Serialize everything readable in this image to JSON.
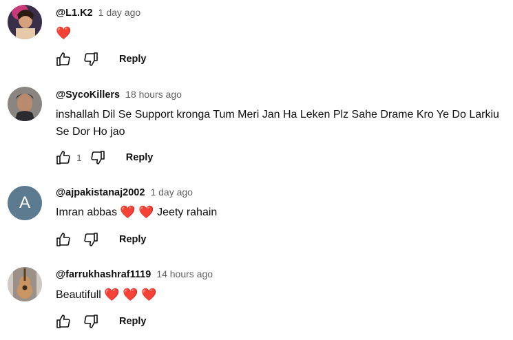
{
  "comments": [
    {
      "author": "@L1.K2",
      "time": "1 day ago",
      "text_before": "",
      "text_after": "",
      "hearts": [
        "❤️"
      ],
      "likes": "",
      "reply_label": "Reply",
      "avatar_type": "photo-dark"
    },
    {
      "author": "@SycoKillers",
      "time": "18 hours ago",
      "text_before": "inshallah Dil Se Support kronga Tum Meri Jan Ha Leken Plz Sahe Drame Kro Ye Do Larkiu Se Dor Ho jao",
      "text_after": "",
      "hearts": [],
      "likes": "1",
      "reply_label": "Reply",
      "avatar_type": "photo-man"
    },
    {
      "author": "@ajpakistanaj2002",
      "time": "1 day ago",
      "text_before": "Imran abbas",
      "text_after": "Jeety rahain",
      "hearts": [
        "❤️",
        "❤️"
      ],
      "likes": "",
      "reply_label": "Reply",
      "avatar_type": "letter",
      "avatar_letter": "A"
    },
    {
      "author": "@farrukhashraf1119",
      "time": "14 hours ago",
      "text_before": "Beautifull",
      "text_after": "",
      "hearts": [
        "❤️",
        "❤️",
        "❤️"
      ],
      "likes": "",
      "reply_label": "Reply",
      "avatar_type": "photo-guitar"
    }
  ],
  "colors": {
    "heart": "#e0245e",
    "secondary_text": "#606060",
    "letter_avatar_bg": "#5c7b91"
  },
  "icons": [
    "thumbs-up-icon",
    "thumbs-down-icon"
  ]
}
